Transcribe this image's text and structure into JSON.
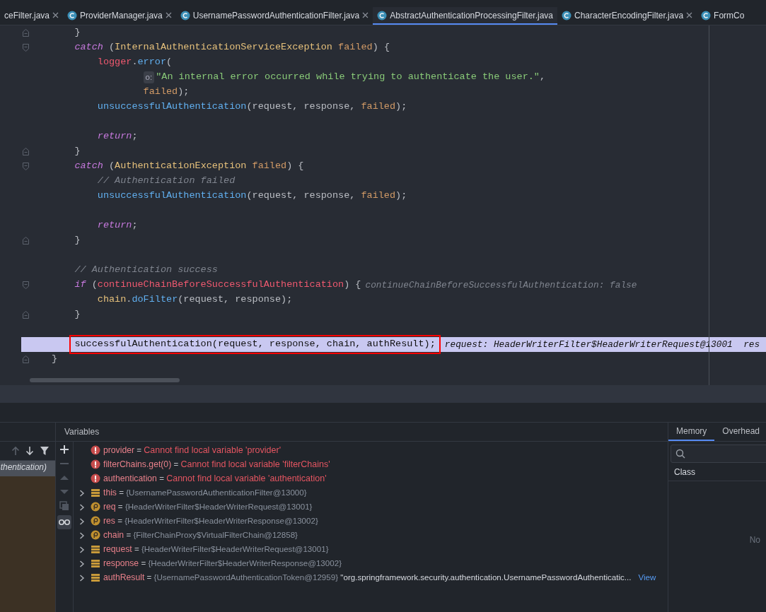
{
  "tabs": [
    {
      "label": "ceFilter.java",
      "selected": false,
      "icon": false,
      "closable": true
    },
    {
      "label": "ProviderManager.java",
      "selected": false,
      "icon": true,
      "closable": true
    },
    {
      "label": "UsernamePasswordAuthenticationFilter.java",
      "selected": false,
      "icon": true,
      "closable": true
    },
    {
      "label": "AbstractAuthenticationProcessingFilter.java",
      "selected": true,
      "icon": true,
      "closable": false
    },
    {
      "label": "CharacterEncodingFilter.java",
      "selected": false,
      "icon": true,
      "closable": true
    },
    {
      "label": "FormCo",
      "selected": false,
      "icon": true,
      "closable": false
    }
  ],
  "editor": {
    "lines": [
      {
        "kind": "group",
        "children": [
          {
            "kind": "fold_end",
            "tokens": [
              {
                "kind": "plain",
                "text": "}"
              }
            ]
          },
          {
            "kind": "fold_start",
            "tokens": [
              {
                "kind": "kw",
                "text": "catch"
              },
              {
                "kind": "plain",
                "text": " ("
              },
              {
                "kind": "class",
                "text": "InternalAuthenticationServiceException"
              },
              {
                "kind": "param",
                "text": " failed"
              },
              {
                "kind": "plain",
                "text": ") {"
              }
            ],
            "children": [
              {
                "kind": "code",
                "tokens": [
                  {
                    "kind": "field",
                    "text": "logger"
                  },
                  {
                    "kind": "plain",
                    "text": "."
                  },
                  {
                    "kind": "method",
                    "text": "error"
                  },
                  {
                    "kind": "plain",
                    "text": "("
                  }
                ],
                "children": [
                  {
                    "kind": "group",
                    "children": [
                      {
                        "kind": "code",
                        "tokens": [
                          {
                            "kind": "hint",
                            "text": "o:"
                          },
                          {
                            "kind": "string",
                            "text": "\"An internal error occurred while trying to authenticate the user.\""
                          },
                          {
                            "kind": "plain",
                            "text": ","
                          }
                        ]
                      },
                      {
                        "kind": "code",
                        "tokens": [
                          {
                            "kind": "param",
                            "text": "failed"
                          },
                          {
                            "kind": "plain",
                            "text": ");"
                          }
                        ]
                      }
                    ]
                  }
                ]
              },
              {
                "kind": "code",
                "tokens": [
                  {
                    "kind": "method",
                    "text": "unsuccessfulAuthentication"
                  },
                  {
                    "kind": "plain",
                    "text": "(request, response, "
                  },
                  {
                    "kind": "param",
                    "text": "failed"
                  },
                  {
                    "kind": "plain",
                    "text": ");"
                  }
                ]
              },
              {
                "kind": "blank"
              },
              {
                "kind": "code",
                "tokens": [
                  {
                    "kind": "kw",
                    "text": "return"
                  },
                  {
                    "kind": "plain",
                    "text": ";"
                  }
                ]
              }
            ]
          },
          {
            "kind": "fold_end",
            "tokens": [
              {
                "kind": "plain",
                "text": "}"
              }
            ]
          },
          {
            "kind": "fold_start",
            "tokens": [
              {
                "kind": "kw",
                "text": "catch"
              },
              {
                "kind": "plain",
                "text": " ("
              },
              {
                "kind": "class",
                "text": "AuthenticationException"
              },
              {
                "kind": "param",
                "text": " failed"
              },
              {
                "kind": "plain",
                "text": ") {"
              }
            ],
            "children": [
              {
                "kind": "code",
                "tokens": [
                  {
                    "kind": "comment",
                    "text": "// Authentication failed"
                  }
                ]
              },
              {
                "kind": "code",
                "tokens": [
                  {
                    "kind": "method",
                    "text": "unsuccessfulAuthentication"
                  },
                  {
                    "kind": "plain",
                    "text": "(request, response, "
                  },
                  {
                    "kind": "param",
                    "text": "failed"
                  },
                  {
                    "kind": "plain",
                    "text": ");"
                  }
                ]
              },
              {
                "kind": "blank"
              },
              {
                "kind": "code",
                "tokens": [
                  {
                    "kind": "kw",
                    "text": "return"
                  },
                  {
                    "kind": "plain",
                    "text": ";"
                  }
                ]
              }
            ]
          },
          {
            "kind": "fold_end",
            "tokens": [
              {
                "kind": "plain",
                "text": "}"
              }
            ]
          },
          {
            "kind": "blank"
          },
          {
            "kind": "code",
            "tokens": [
              {
                "kind": "comment",
                "text": "// Authentication success"
              }
            ]
          },
          {
            "kind": "fold_start",
            "tokens": [
              {
                "kind": "kw",
                "text": "if"
              },
              {
                "kind": "plain",
                "text": " ("
              },
              {
                "kind": "field",
                "text": "continueChainBeforeSuccessfulAuthentication"
              },
              {
                "kind": "plain",
                "text": ") {"
              }
            ],
            "inline_hint": "continueChainBeforeSuccessfulAuthentication: false",
            "children": [
              {
                "kind": "code",
                "tokens": [
                  {
                    "kind": "var",
                    "text": "chain"
                  },
                  {
                    "kind": "plain",
                    "text": "."
                  },
                  {
                    "kind": "method",
                    "text": "doFilter"
                  },
                  {
                    "kind": "plain",
                    "text": "(request, response);"
                  }
                ]
              }
            ]
          },
          {
            "kind": "fold_end",
            "tokens": [
              {
                "kind": "plain",
                "text": "}"
              }
            ]
          },
          {
            "kind": "blank"
          },
          {
            "kind": "code",
            "current": true,
            "boxed": true,
            "tokens": [
              {
                "kind": "method",
                "text": "successfulAuthentication"
              },
              {
                "kind": "plain",
                "text": "(request, response, chain, authResult);"
              }
            ],
            "inline_hint": "request: HeaderWriterFilter$HeaderWriterRequest@13001  res"
          }
        ]
      },
      {
        "kind": "fold_end",
        "tokens": [
          {
            "kind": "plain",
            "text": "}"
          }
        ]
      }
    ]
  },
  "frames": {
    "items": [
      {
        "label": "thentication)",
        "selected": true
      }
    ]
  },
  "variables": {
    "title": "Variables",
    "items": [
      {
        "kind": "error",
        "expandable": false,
        "name": "provider",
        "equals": "=",
        "value": "Cannot find local variable 'provider'"
      },
      {
        "kind": "error",
        "expandable": false,
        "name": "filterChains.get(0)",
        "equals": "=",
        "value": "Cannot find local variable 'filterChains'"
      },
      {
        "kind": "error",
        "expandable": false,
        "name": "authentication",
        "equals": "=",
        "value": "Cannot find local variable 'authentication'"
      },
      {
        "kind": "field",
        "expandable": true,
        "name": "this",
        "equals": "=",
        "value": "{UsernamePasswordAuthenticationFilter@13000}"
      },
      {
        "kind": "param",
        "expandable": true,
        "name": "req",
        "equals": "=",
        "value": "{HeaderWriterFilter$HeaderWriterRequest@13001}"
      },
      {
        "kind": "param",
        "expandable": true,
        "name": "res",
        "equals": "=",
        "value": "{HeaderWriterFilter$HeaderWriterResponse@13002}"
      },
      {
        "kind": "param",
        "expandable": true,
        "name": "chain",
        "equals": "=",
        "value": "{FilterChainProxy$VirtualFilterChain@12858}"
      },
      {
        "kind": "field",
        "expandable": true,
        "name": "request",
        "equals": "=",
        "value": "{HeaderWriterFilter$HeaderWriterRequest@13001}"
      },
      {
        "kind": "field",
        "expandable": true,
        "name": "response",
        "equals": "=",
        "value": "{HeaderWriterFilter$HeaderWriterResponse@13002}"
      },
      {
        "kind": "field",
        "expandable": true,
        "name": "authResult",
        "equals": "=",
        "value": "{UsernamePasswordAuthenticationToken@12959}",
        "string": "\"org.springframework.security.authentication.UsernamePasswordAuthenticatic...",
        "link": "View"
      }
    ]
  },
  "memory": {
    "tabs": [
      {
        "label": "Memory",
        "selected": true
      },
      {
        "label": "Overhead",
        "selected": false
      }
    ],
    "column": "Class",
    "empty_text": "No"
  }
}
